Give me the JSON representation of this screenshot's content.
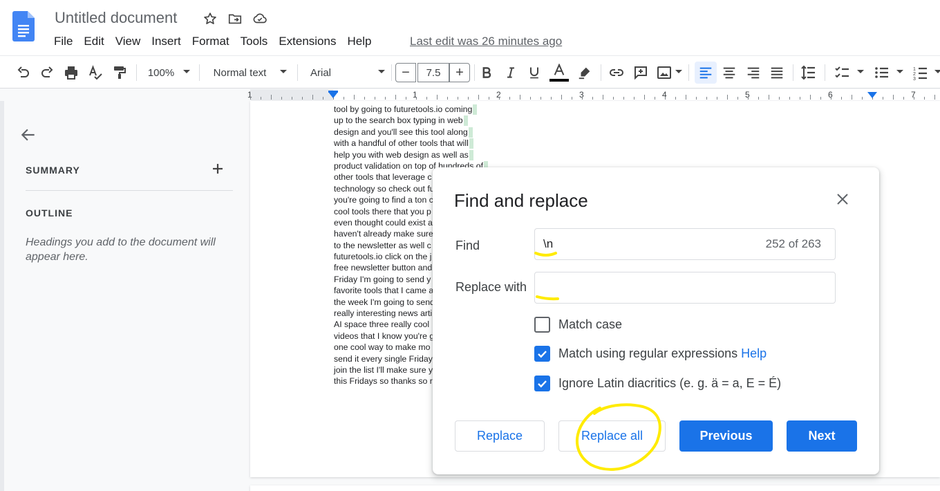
{
  "window": {
    "doc_title": "Untitled document",
    "last_edit": "Last edit was 26 minutes ago"
  },
  "menu": [
    "File",
    "Edit",
    "View",
    "Insert",
    "Format",
    "Tools",
    "Extensions",
    "Help"
  ],
  "toolbar": {
    "zoom": "100%",
    "style": "Normal text",
    "font": "Arial",
    "font_size": "7.5",
    "minus": "−",
    "plus": "+"
  },
  "ruler": {
    "numbers": [
      "1",
      "1",
      "2",
      "3",
      "4",
      "5",
      "6",
      "7"
    ]
  },
  "outline_panel": {
    "summary": "SUMMARY",
    "outline": "OUTLINE",
    "hint": "Headings you add to the document will appear here."
  },
  "document": {
    "lines": [
      "tool by going to futuretools.io coming",
      "up to the search box typing in web",
      "design and you'll see this tool along",
      "with a handful of other tools that will",
      "help you with web design as well as",
      "product validation on top of hundreds of",
      "other tools that leverage c",
      "technology so check out fu",
      "you're going to find a ton c",
      "cool tools there that you p",
      "even thought could exist a",
      "haven't already make sure",
      "to the newsletter as well c",
      "futuretools.io click on the j",
      "free newsletter button and",
      "Friday I'm going to send y",
      "favorite tools that I came a",
      "the week I'm going to send",
      "really interesting news arti",
      "AI space three really cool",
      "videos that I know you're g",
      "one cool way to make mo",
      "send it every single Friday",
      "join the list I'll make sure y",
      "this Fridays so thanks so r"
    ]
  },
  "dialog": {
    "title": "Find and replace",
    "find_label": "Find",
    "find_value": "\\n",
    "match_count": "252 of 263",
    "replace_label": "Replace with",
    "replace_value": "",
    "match_case": "Match case",
    "regex": "Match using regular expressions",
    "help": "Help",
    "diacritics": "Ignore Latin diacritics (e. g. ä = a, E = É)",
    "buttons": {
      "replace": "Replace",
      "replace_all": "Replace all",
      "previous": "Previous",
      "next": "Next"
    }
  },
  "states": {
    "match_case": false,
    "regex": true,
    "diacritics": true
  },
  "colors": {
    "accent": "#1a73e8",
    "annotation": "#ffeb00",
    "match_highlight": "#ceead6",
    "spell_underline": "#ea4335"
  }
}
